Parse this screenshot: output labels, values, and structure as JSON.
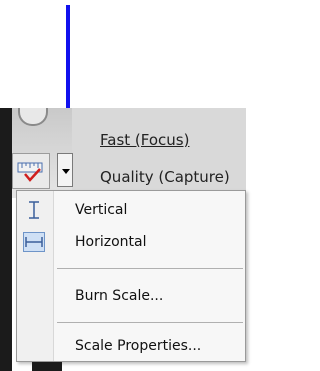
{
  "annotation": {
    "arrow_color": "#1111ee",
    "arrow_icon": "arrow-down-icon"
  },
  "background_menu": {
    "fast_label": "Fast (Focus)",
    "quality_label": "Quality (Capture)"
  },
  "menu": {
    "items": [
      {
        "label": "Vertical",
        "icon": "vertical-scale-icon",
        "checked": false
      },
      {
        "label": "Horizontal",
        "icon": "horizontal-scale-icon",
        "checked": true
      },
      {
        "label": "Burn Scale..."
      },
      {
        "label": "Scale Properties..."
      }
    ]
  }
}
